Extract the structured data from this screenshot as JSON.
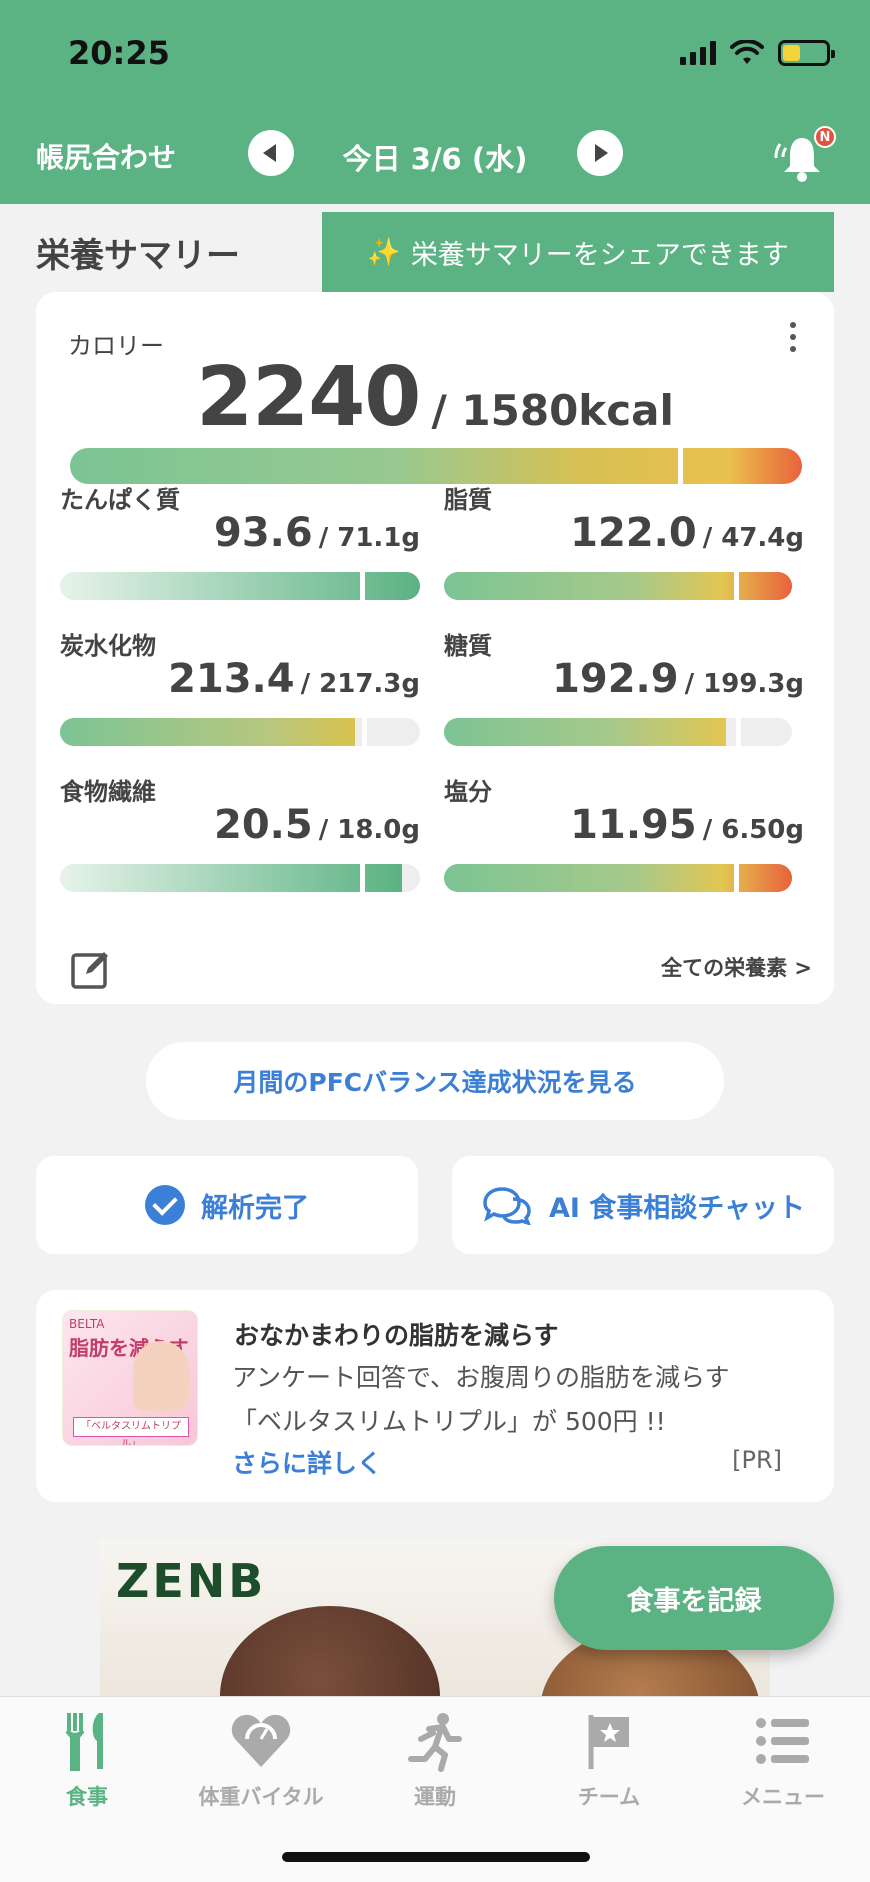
{
  "status": {
    "time": "20:25"
  },
  "nav": {
    "left_link": "帳尻合わせ",
    "date": "今日 3/6 (水)",
    "notification_badge": "N"
  },
  "summary": {
    "title": "栄養サマリー",
    "share_tip": "栄養サマリーをシェアできます",
    "calorie_label": "カロリー",
    "calorie_value": "2240",
    "calorie_target": "/ 1580kcal",
    "all_nutrients": "全ての栄養素 >",
    "nutrients": [
      {
        "name": "たんぱく質",
        "value": "93.6",
        "target": "/ 71.1g",
        "fill": 1.0,
        "marker": 0.76
      },
      {
        "name": "脂質",
        "value": "122.0",
        "target": "/ 47.4g",
        "fill": 1.0,
        "marker": 0.82
      },
      {
        "name": "炭水化物",
        "value": "213.4",
        "target": "/ 217.3g",
        "fill": 0.82,
        "marker": 0.84
      },
      {
        "name": "糖質",
        "value": "192.9",
        "target": "/ 199.3g",
        "fill": 0.81,
        "marker": 0.84
      },
      {
        "name": "食物繊維",
        "value": "20.5",
        "target": "/ 18.0g",
        "fill": 0.95,
        "marker": 0.84
      },
      {
        "name": "塩分",
        "value": "11.95",
        "target": "/ 6.50g",
        "fill": 1.0,
        "marker": 0.84
      }
    ]
  },
  "pfc_button": "月間のPFCバランス達成状況を見る",
  "analysis_button": "解析完了",
  "ai_chat_button": "AI 食事相談チャット",
  "ad": {
    "image_text_1": "BELTA",
    "image_text_2": "脂肪を減らす",
    "image_pack": "「ベルタスリムトリプル」",
    "title": "おなかまわりの脂肪を減らす",
    "line1": "アンケート回答で、お腹周りの脂肪を減らす",
    "line2": "「ベルタスリムトリプル」が 500円 !!",
    "more": "さらに詳しく",
    "pr": "[PR]"
  },
  "banner": {
    "brand": "ZENB"
  },
  "fab": "食事を記録",
  "tabs": [
    {
      "label": "食事",
      "icon": "fork-knife-icon",
      "active": true
    },
    {
      "label": "体重バイタル",
      "icon": "heart-scale-icon",
      "active": false
    },
    {
      "label": "運動",
      "icon": "runner-icon",
      "active": false
    },
    {
      "label": "チーム",
      "icon": "flag-icon",
      "active": false
    },
    {
      "label": "メニュー",
      "icon": "list-icon",
      "active": false
    }
  ],
  "colors": {
    "brand_green": "#5bb283",
    "link_blue": "#3b7fd6",
    "alert_red": "#e9623b"
  }
}
